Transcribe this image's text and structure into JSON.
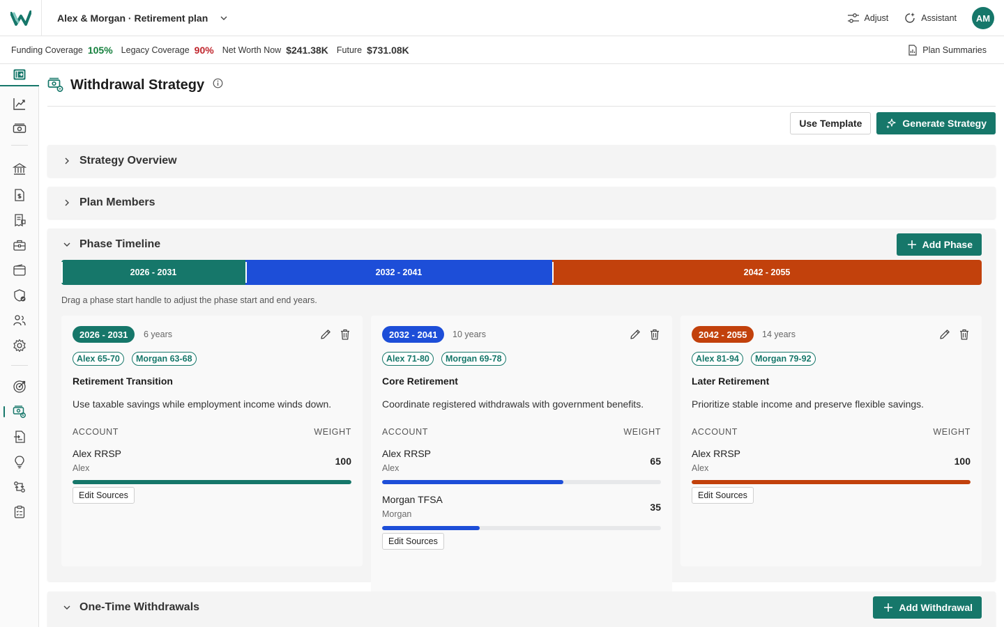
{
  "header": {
    "plan_title": "Alex & Morgan · Retirement plan",
    "adjust_label": "Adjust",
    "assistant_label": "Assistant",
    "avatar_initials": "AM"
  },
  "stats": {
    "funding_label": "Funding Coverage",
    "funding_value": "105%",
    "legacy_label": "Legacy Coverage",
    "legacy_value": "90%",
    "networth_label": "Net Worth Now",
    "networth_value": "$241.38K",
    "future_label": "Future",
    "future_value": "$731.08K",
    "summaries_label": "Plan Summaries"
  },
  "colors": {
    "accent": "#16776a",
    "positive": "#15803d",
    "negative": "#c0262d",
    "phase1": "#16776a",
    "phase2": "#1d4ed8",
    "phase3": "#c2410c"
  },
  "sidebar": {
    "items": [
      "collapse-sidebar-icon",
      "chart-line-icon",
      "cash-icon",
      "bank-icon",
      "document-money-icon",
      "receipt-icon",
      "briefcase-icon",
      "wallet-icon",
      "shield-check-icon",
      "users-icon",
      "gear-icon",
      "target-icon",
      "withdrawal-strategy-icon",
      "document-transfer-icon",
      "lightbulb-icon",
      "swap-icon",
      "clipboard-icon"
    ]
  },
  "page": {
    "title": "Withdrawal Strategy",
    "use_template_label": "Use Template",
    "generate_label": "Generate Strategy"
  },
  "sections": {
    "overview": "Strategy Overview",
    "members": "Plan Members",
    "timeline": "Phase Timeline",
    "add_phase": "Add Phase",
    "hint": "Drag a phase start handle to adjust the phase start and end years.",
    "onetime": "One-Time Withdrawals",
    "add_withdrawal": "Add Withdrawal"
  },
  "phases": [
    {
      "range": "2026 - 2031",
      "years": 6,
      "duration": "6 years",
      "chips": [
        "Alex 65-70",
        "Morgan 63-68"
      ],
      "name": "Retirement Transition",
      "desc": "Use taxable savings while employment income winds down.",
      "account_header": "ACCOUNT",
      "weight_header": "WEIGHT",
      "accounts": [
        {
          "name": "Alex RRSP",
          "owner": "Alex",
          "weight": "100",
          "weight_value": 100
        }
      ],
      "edit_label": "Edit Sources"
    },
    {
      "range": "2032 - 2041",
      "years": 10,
      "duration": "10 years",
      "chips": [
        "Alex 71-80",
        "Morgan 69-78"
      ],
      "name": "Core Retirement",
      "desc": "Coordinate registered withdrawals with government benefits.",
      "account_header": "ACCOUNT",
      "weight_header": "WEIGHT",
      "accounts": [
        {
          "name": "Alex RRSP",
          "owner": "Alex",
          "weight": "65",
          "weight_value": 65
        },
        {
          "name": "Morgan TFSA",
          "owner": "Morgan",
          "weight": "35",
          "weight_value": 35
        }
      ],
      "edit_label": "Edit Sources"
    },
    {
      "range": "2042 - 2055",
      "years": 14,
      "duration": "14 years",
      "chips": [
        "Alex 81-94",
        "Morgan 79-92"
      ],
      "name": "Later Retirement",
      "desc": "Prioritize stable income and preserve flexible savings.",
      "account_header": "ACCOUNT",
      "weight_header": "WEIGHT",
      "accounts": [
        {
          "name": "Alex RRSP",
          "owner": "Alex",
          "weight": "100",
          "weight_value": 100
        }
      ],
      "edit_label": "Edit Sources"
    }
  ]
}
